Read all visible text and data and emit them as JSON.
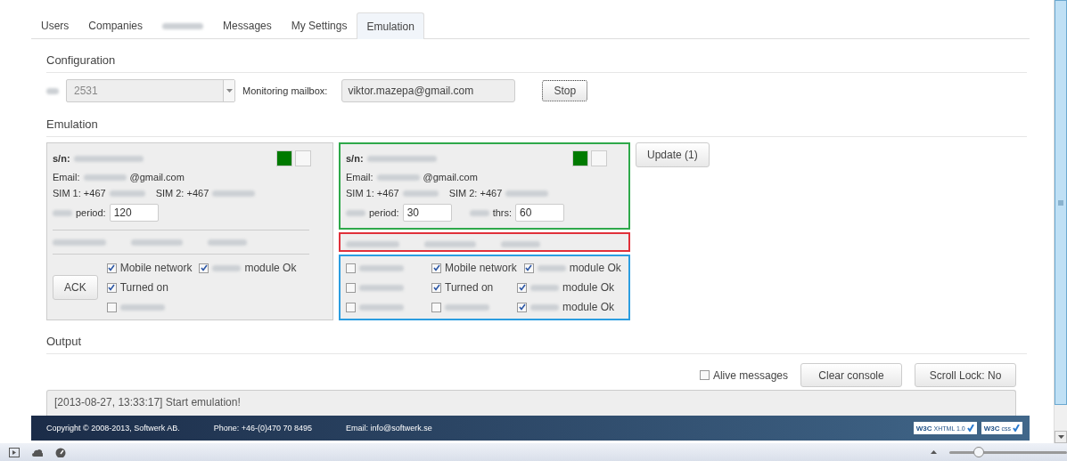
{
  "tabs": [
    {
      "label": "Users",
      "selected": false
    },
    {
      "label": "Companies",
      "selected": false
    },
    {
      "blurred": true,
      "selected": false
    },
    {
      "label": "Messages",
      "selected": false
    },
    {
      "label": "My Settings",
      "selected": false
    },
    {
      "label": "Emulation",
      "selected": true
    }
  ],
  "configuration": {
    "title": "Configuration",
    "device_value": "2531",
    "mailbox_label": "Monitoring mailbox:",
    "mailbox_value": "viktor.mazepa@gmail.com",
    "button": "Stop"
  },
  "emulation": {
    "title": "Emulation",
    "update_button": "Update (1)",
    "devices": [
      {
        "outlined": false,
        "sn_label": "s/n:",
        "email_label": "Email:",
        "email_suffix": "@gmail.com",
        "sim1": "SIM 1: +467",
        "sim2": "SIM 2: +467",
        "indicators": [
          {
            "color": "#007a00"
          },
          {
            "color": "#f7f7f7"
          }
        ],
        "fields": [
          {
            "label": "period:",
            "value": "120"
          }
        ],
        "ack_button": "ACK",
        "checks": [
          [
            {
              "checked": true,
              "label": "Mobile network"
            },
            {
              "checked": true,
              "blur_prefix": true,
              "label": "module Ok"
            }
          ],
          [
            {
              "checked": true,
              "label": "Turned on"
            }
          ],
          [
            {
              "checked": false
            }
          ]
        ]
      },
      {
        "outlined": true,
        "sn_label": "s/n:",
        "email_label": "Email:",
        "email_suffix": "@gmail.com",
        "sim1": "SIM 1: +467",
        "sim2": "SIM 2: +467",
        "indicators": [
          {
            "color": "#007a00"
          },
          {
            "color": "#f7f7f7"
          }
        ],
        "fields": [
          {
            "label": "period:",
            "value": "30"
          },
          {
            "label": "thrs:",
            "value": "60"
          }
        ],
        "checks": [
          [
            {
              "checked": false
            },
            {
              "checked": true,
              "label": "Mobile network"
            },
            {
              "checked": true,
              "blur_prefix": true,
              "label": "module Ok"
            }
          ],
          [
            {
              "checked": false
            },
            {
              "checked": true,
              "label": "Turned on"
            },
            {
              "checked": true,
              "blur_prefix": true,
              "label": "module Ok"
            }
          ],
          [
            {
              "checked": false
            },
            {
              "checked": false
            },
            {
              "checked": true,
              "blur_prefix": true,
              "label": "module Ok"
            }
          ]
        ]
      }
    ]
  },
  "output": {
    "title": "Output",
    "alive": {
      "label": "Alive messages",
      "checked": false
    },
    "buttons": [
      "Clear console",
      "Scroll Lock: No"
    ],
    "console": [
      "[2013-08-27, 13:33:17] Start emulation!"
    ]
  },
  "footer": {
    "texts": [
      "Copyright © 2008-2013, Softwerk AB.",
      "Phone: +46-(0)470 70 8495",
      "Email: info@softwerk.se"
    ],
    "badges": [
      {
        "mark": "W3C",
        "label": "XHTML 1.0"
      },
      {
        "mark": "W3C",
        "label": "css"
      }
    ]
  },
  "browser_status": {
    "zoom": {
      "level": 0.25
    }
  }
}
